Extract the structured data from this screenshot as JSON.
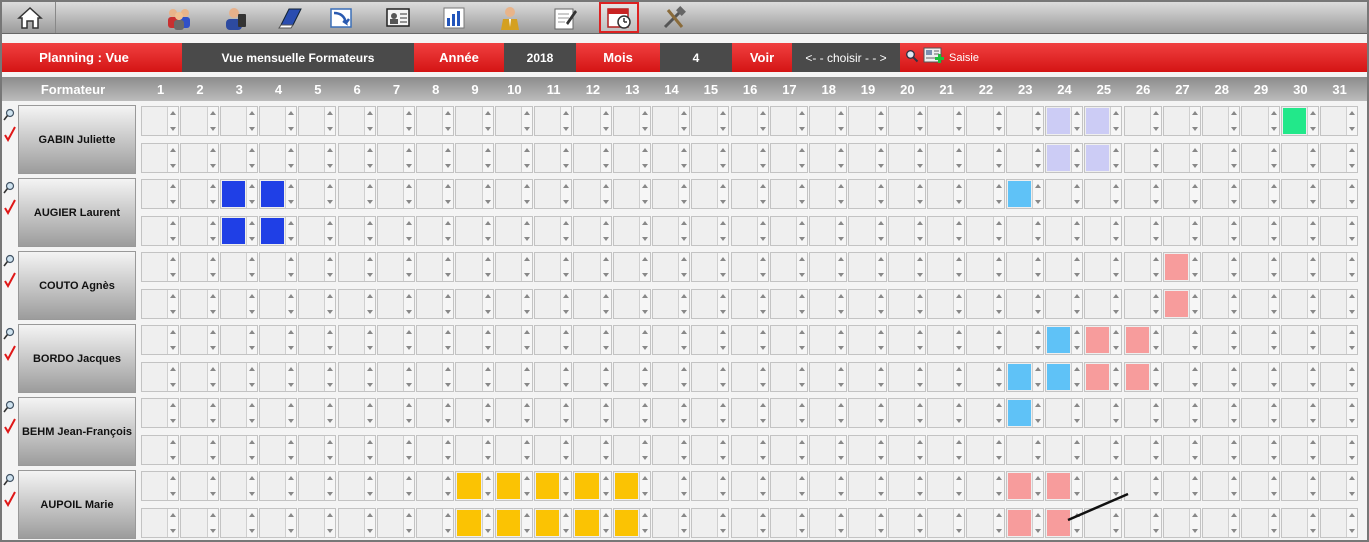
{
  "toolbar": {
    "icons": [
      "home-icon",
      "users-group-icon",
      "phone-user-icon",
      "book-icon",
      "import-arrow-icon",
      "id-card-icon",
      "bar-chart-icon",
      "person-suit-icon",
      "edit-note-icon",
      "calendar-clock-icon",
      "tools-icon"
    ],
    "active_index": 9
  },
  "header": {
    "planning_label": "Planning : Vue",
    "view_name": "Vue mensuelle Formateurs",
    "year_label": "Année",
    "year_value": "2018",
    "month_label": "Mois",
    "month_value": "4",
    "voir_label": "Voir",
    "choose_label": "<- - choisir - - >",
    "saisie_label": "Saisie"
  },
  "grid": {
    "formateur_label": "Formateur",
    "days": [
      "1",
      "2",
      "3",
      "4",
      "5",
      "6",
      "7",
      "8",
      "9",
      "10",
      "11",
      "12",
      "13",
      "14",
      "15",
      "16",
      "17",
      "18",
      "19",
      "20",
      "21",
      "22",
      "23",
      "24",
      "25",
      "26",
      "27",
      "28",
      "29",
      "30",
      "31"
    ],
    "trainers": [
      {
        "name": "GABIN Juliette",
        "am": {
          "24": "lavender",
          "25": "lavender",
          "30": "green"
        },
        "pm": {
          "24": "lavender",
          "25": "lavender"
        }
      },
      {
        "name": "AUGIER Laurent",
        "am": {
          "3": "blue",
          "4": "blue",
          "23": "sky"
        },
        "pm": {
          "3": "blue",
          "4": "blue"
        }
      },
      {
        "name": "COUTO Agnès",
        "am": {
          "27": "pink"
        },
        "pm": {
          "27": "pink"
        }
      },
      {
        "name": "BORDO Jacques",
        "am": {
          "24": "sky",
          "25": "pink",
          "26": "pink"
        },
        "pm": {
          "23": "sky",
          "24": "sky",
          "25": "pink",
          "26": "pink"
        }
      },
      {
        "name": "BEHM Jean-François",
        "am": {
          "23": "sky"
        },
        "pm": {}
      },
      {
        "name": "AUPOIL Marie",
        "am": {
          "9": "gold",
          "10": "gold",
          "11": "gold",
          "12": "gold",
          "13": "gold",
          "23": "pink",
          "24": "pink"
        },
        "pm": {
          "9": "gold",
          "10": "gold",
          "11": "gold",
          "12": "gold",
          "13": "gold",
          "23": "pink",
          "24": "pink"
        }
      }
    ]
  },
  "colors": {
    "lavender": "#ccccf5",
    "green": "#22e88a",
    "blue": "#1f3fe6",
    "sky": "#5fc2f7",
    "pink": "#f79c9c",
    "gold": "#fbc303",
    "header_red": "#e32020",
    "header_dark": "#4a4a4a"
  }
}
